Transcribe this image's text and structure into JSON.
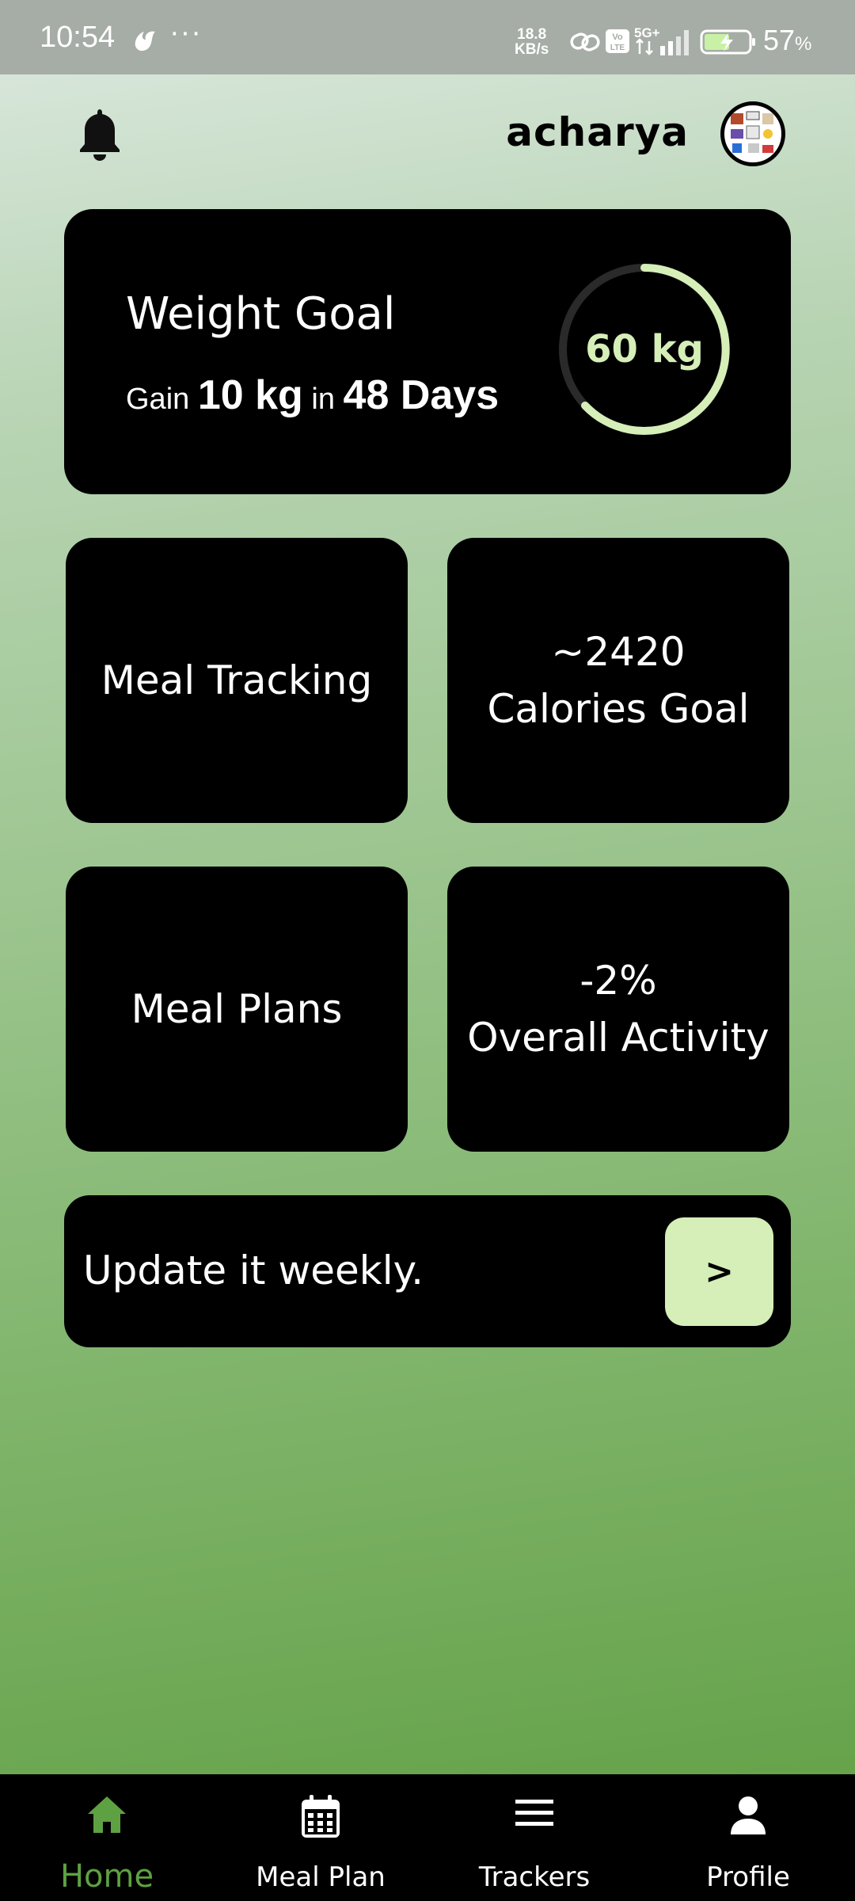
{
  "status_bar": {
    "time": "10:54",
    "dots": "···",
    "speed_top": "18.8",
    "speed_bottom": "KB/s",
    "network": "5G+",
    "battery_pct": "57",
    "battery_unit": "%",
    "battery_level": 0.57
  },
  "header": {
    "username": "acharya",
    "bell_icon": "bell-icon",
    "avatar_icon": "profile-avatar"
  },
  "weight_goal": {
    "title": "Weight Goal",
    "gain_word": "Gain",
    "gain_amount": "10 kg",
    "in_word": "in",
    "days": "48 Days",
    "target_label": "60 kg",
    "accent_color": "#d6eeb8"
  },
  "tiles": {
    "meal_tracking": "Meal Tracking",
    "calories_value": "~2420",
    "calories_label": "Calories Goal",
    "meal_plans": "Meal Plans",
    "activity_value": "-2%",
    "activity_label": "Overall Activity"
  },
  "update": {
    "text": "Update it weekly.",
    "button_label": ">"
  },
  "nav": {
    "items": [
      {
        "label": "Home",
        "icon": "home-icon",
        "active": true
      },
      {
        "label": "Meal Plan",
        "icon": "calendar-icon",
        "active": false
      },
      {
        "label": "Trackers",
        "icon": "menu-icon",
        "active": false
      },
      {
        "label": "Profile",
        "icon": "person-icon",
        "active": false
      }
    ],
    "active_color": "#5ea142"
  }
}
